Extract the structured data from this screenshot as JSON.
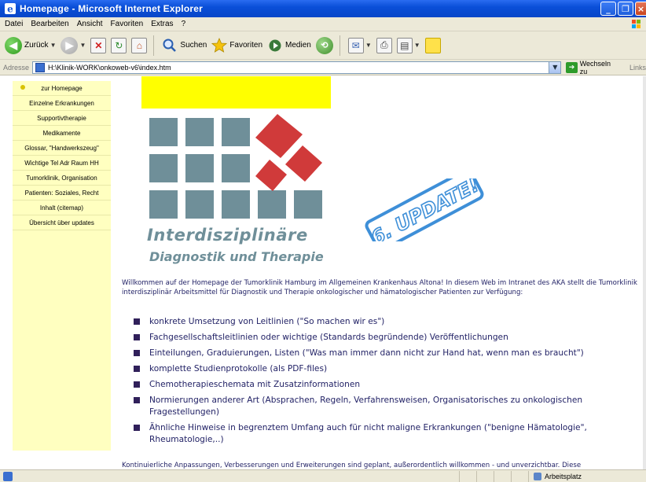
{
  "window": {
    "title": "Homepage - Microsoft Internet Explorer"
  },
  "menu": [
    "Datei",
    "Bearbeiten",
    "Ansicht",
    "Favoriten",
    "Extras",
    "?"
  ],
  "toolbar": {
    "back_label": "Zurück",
    "search_label": "Suchen",
    "favorites_label": "Favoriten",
    "media_label": "Medien"
  },
  "address": {
    "label": "Adresse",
    "url": "H:\\Klinik-WORK\\onkoweb-v6\\index.htm",
    "go_label": "Wechseln zu",
    "links_label": "Links"
  },
  "nav": {
    "items": [
      "zur Homepage",
      "Einzelne Erkrankungen",
      "Supportivtherapie",
      "Medikamente",
      "Glossar, \"Handwerkszeug\"",
      "Wichtige Tel Adr Raum HH",
      "Tumorklinik, Organisation",
      "Patienten: Soziales, Recht",
      "Inhalt (citemap)",
      "Übersicht über updates"
    ]
  },
  "logo": {
    "line1": "Interdisziplinäre",
    "line2": "Diagnostik und Therapie"
  },
  "stamp": {
    "text": "6. UPDATE!"
  },
  "content": {
    "intro": "Willkommen auf der Homepage der Tumorklinik Hamburg im Allgemeinen Krankenhaus Altona! In diesem Web im Intranet des AKA stellt die Tumorklinik interdisziplinär Arbeitsmittel für Diagnostik und Therapie onkologischer und hämatologischer Patienten zur Verfügung:",
    "bullets": [
      "konkrete Umsetzung von Leitlinien (\"So machen wir es\")",
      "Fachgesellschaftsleitlinien oder wichtige (Standards begründende) Veröffentlichungen",
      "Einteilungen, Graduierungen, Listen (\"Was man immer dann nicht zur Hand hat, wenn man es braucht\")",
      "komplette Studienprotokolle (als PDF-files)",
      "Chemotherapieschemata mit Zusatzinformationen",
      "Normierungen anderer Art (Absprachen, Regeln, Verfahrensweisen, Organisatorisches zu onkologischen Fragestellungen)",
      "Ähnliche Hinweise in begrenztem Umfang auch für nicht maligne Erkrankungen (\"benigne Hämatologie\", Rheumatologie,..)"
    ],
    "outro": "Kontinuierliche Anpassungen, Verbesserungen und Erweiterungen sind geplant, außerordentlich willkommen - und unverzichtbar. Diese"
  },
  "status": {
    "zone_label": "Arbeitsplatz"
  },
  "colors": {
    "nav_background": "#ffffc0",
    "highlight_bar": "#ffff00",
    "logo_squares": "#6f8f99",
    "logo_diamonds": "#d03a3a",
    "stamp": "#3e8fd8",
    "body_text": "#222266"
  }
}
